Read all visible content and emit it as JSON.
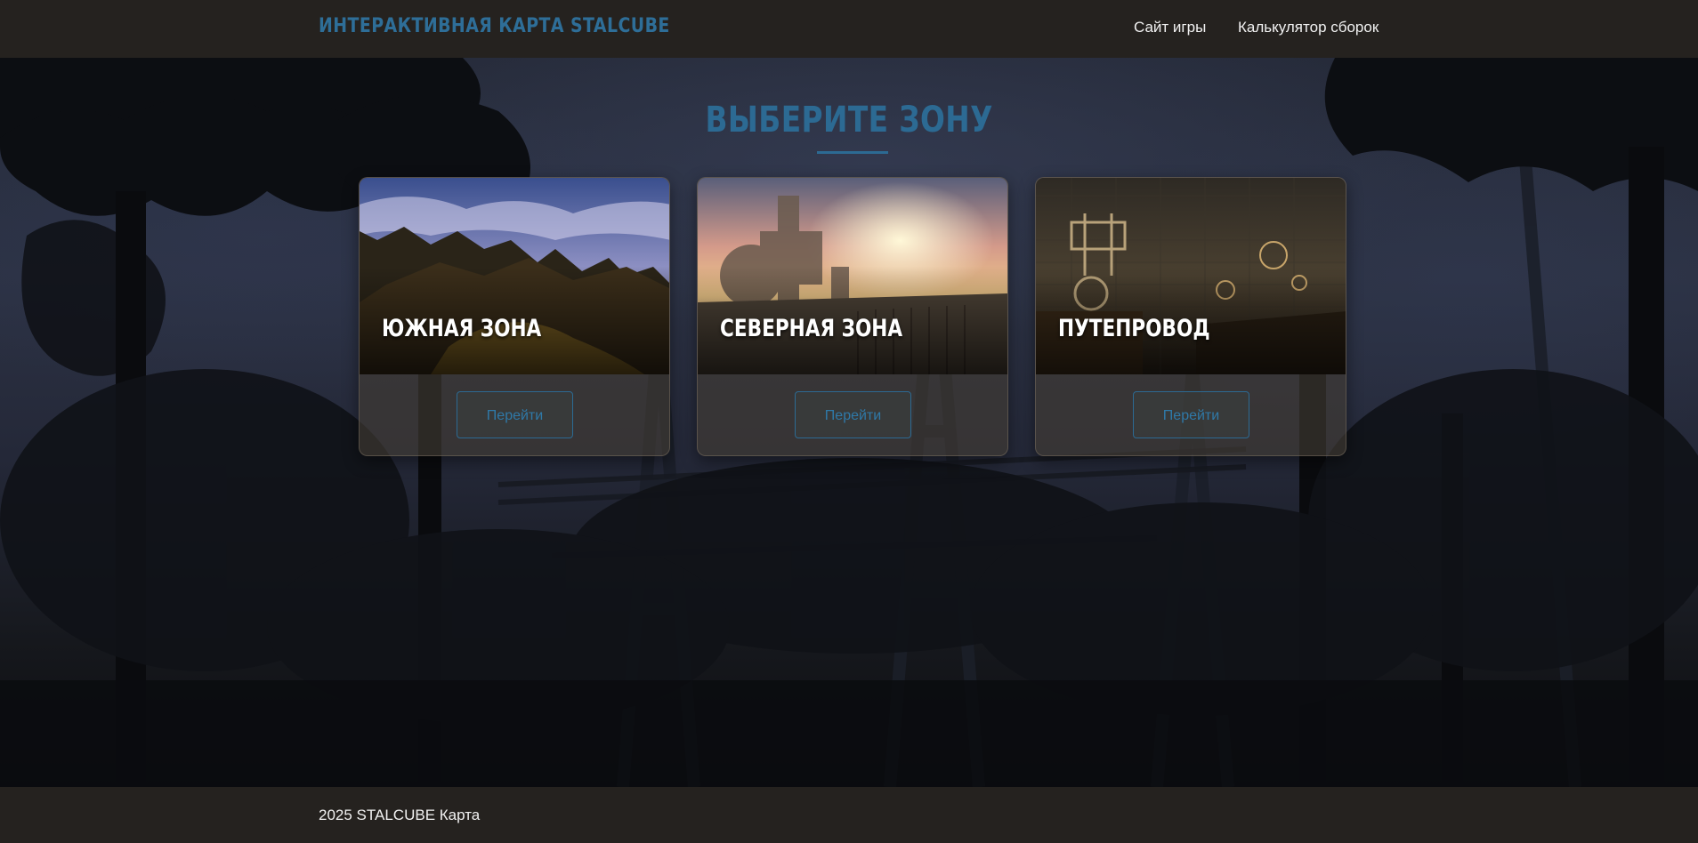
{
  "header": {
    "brand": "ИНТЕРАКТИВНАЯ КАРТА STALCUBE",
    "nav": [
      {
        "label": "Сайт игры"
      },
      {
        "label": "Калькулятор сборок"
      }
    ]
  },
  "main": {
    "title": "ВЫБЕРИТЕ ЗОНУ",
    "zones": [
      {
        "title": "ЮЖНАЯ ЗОНА",
        "button": "Перейти"
      },
      {
        "title": "СЕВЕРНАЯ ЗОНА",
        "button": "Перейти"
      },
      {
        "title": "ПУТЕПРОВОД",
        "button": "Перейти"
      }
    ]
  },
  "footer": {
    "text": "2025 STALCUBE Карта"
  },
  "colors": {
    "accent": "#2c6a93",
    "bar": "#25221f",
    "nav_text": "#f1f1f1"
  }
}
